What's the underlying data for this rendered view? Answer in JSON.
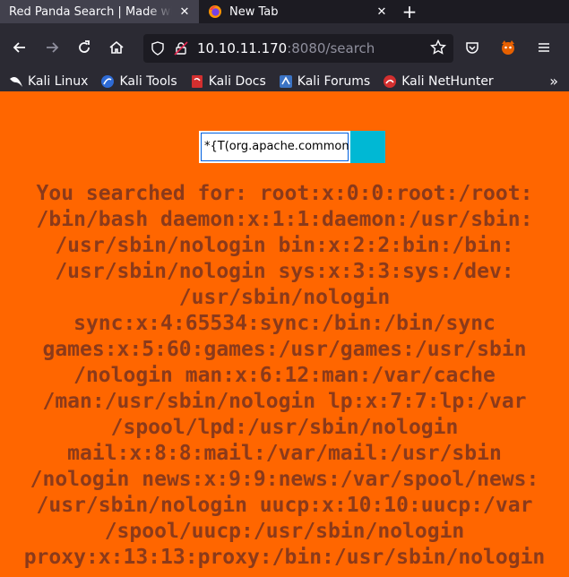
{
  "tabs": [
    {
      "title": "Red Panda Search | Made with",
      "close": "✕"
    },
    {
      "title": "New Tab",
      "close": "✕"
    }
  ],
  "new_tab": "+",
  "url": {
    "host": "10.10.11.170",
    "rest": ":8080/search"
  },
  "bookmarks": [
    {
      "label": "Kali Linux"
    },
    {
      "label": "Kali Tools"
    },
    {
      "label": "Kali Docs"
    },
    {
      "label": "Kali Forums"
    },
    {
      "label": "Kali NetHunter"
    }
  ],
  "bookmarks_more": "»",
  "search": {
    "value": "*{T(org.apache.commons.io"
  },
  "result_lines": [
    "You searched for: root:x:0:0:root:/root:",
    "/bin/bash daemon:x:1:1:daemon:/usr/sbin:",
    "/usr/sbin/nologin bin:x:2:2:bin:/bin:",
    "/usr/sbin/nologin sys:x:3:3:sys:/dev:",
    "/usr/sbin/nologin",
    "sync:x:4:65534:sync:/bin:/bin/sync",
    "games:x:5:60:games:/usr/games:/usr/sbin",
    "/nologin man:x:6:12:man:/var/cache",
    "/man:/usr/sbin/nologin lp:x:7:7:lp:/var",
    "/spool/lpd:/usr/sbin/nologin",
    "mail:x:8:8:mail:/var/mail:/usr/sbin",
    "/nologin news:x:9:9:news:/var/spool/news:",
    "/usr/sbin/nologin uucp:x:10:10:uucp:/var",
    "/spool/uucp:/usr/sbin/nologin",
    "proxy:x:13:13:proxy:/bin:/usr/sbin/nologin"
  ],
  "colors": {
    "page_bg": "#ff6600",
    "result_text": "#8b3a1a",
    "button": "#00b8d4"
  }
}
